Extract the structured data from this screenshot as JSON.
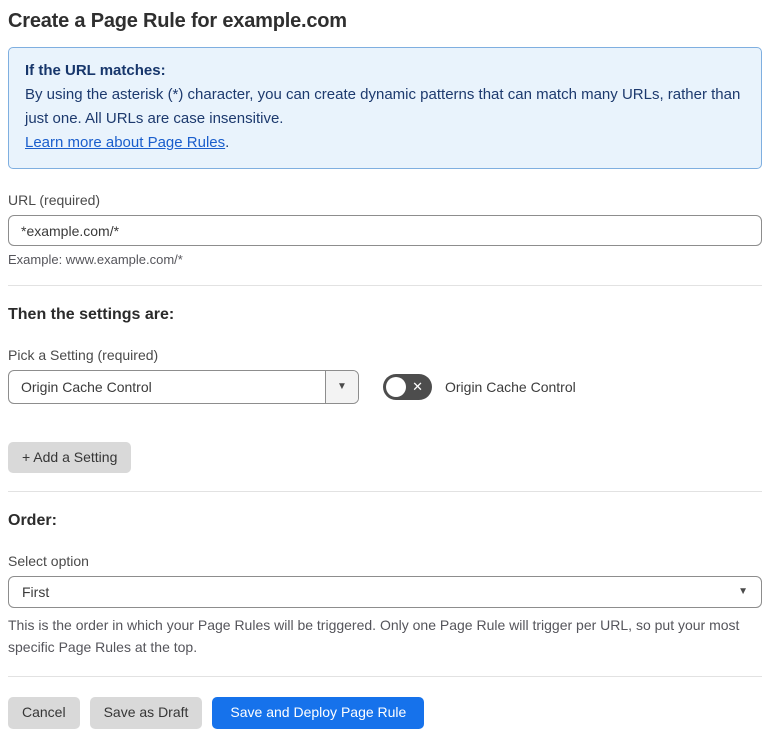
{
  "page": {
    "title": "Create a Page Rule for example.com"
  },
  "info_box": {
    "heading": "If the URL matches:",
    "body": "By using the asterisk (*) character, you can create dynamic patterns that can match many URLs, rather than just one. All URLs are case insensitive.",
    "link_label": "Learn more about Page Rules",
    "link_suffix": "."
  },
  "url_section": {
    "label": "URL (required)",
    "value": "*example.com/*",
    "helper": "Example: www.example.com/*"
  },
  "settings_section": {
    "heading": "Then the settings are:",
    "picker_label": "Pick a Setting (required)",
    "selected_setting": "Origin Cache Control",
    "toggle_label": "Origin Cache Control",
    "toggle_state": "off",
    "toggle_glyph": "✕",
    "add_setting_label": "+ Add a Setting"
  },
  "order_section": {
    "heading": "Order:",
    "select_label": "Select option",
    "selected_option": "First",
    "helper": "This is the order in which your Page Rules will be triggered. Only one Page Rule will trigger per URL, so put your most specific Page Rules at the top."
  },
  "footer": {
    "cancel_label": "Cancel",
    "save_draft_label": "Save as Draft",
    "save_deploy_label": "Save and Deploy Page Rule"
  },
  "icons": {
    "dropdown_caret": "▼"
  },
  "colors": {
    "accent_blue": "#1672eb",
    "info_background": "#e9f3fc",
    "info_border": "#7fafe0",
    "info_text": "#1d3a6e",
    "link_blue": "#1a5ecc",
    "toggle_background": "#4d4d4d",
    "button_gray": "#d9d9d9",
    "divider": "#e2e2e2"
  }
}
